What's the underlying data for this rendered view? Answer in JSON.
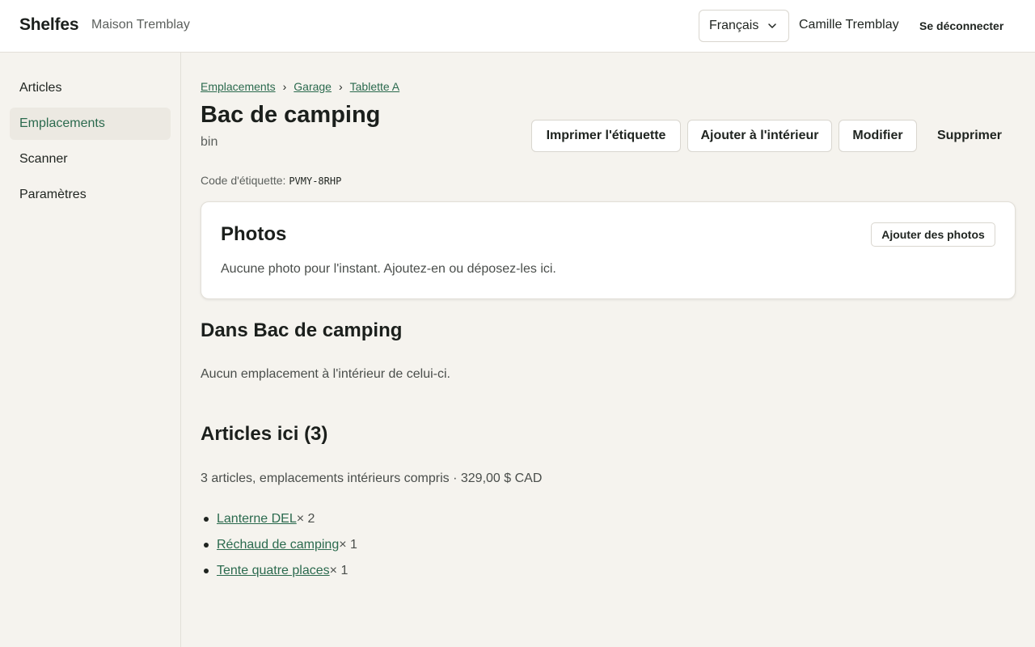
{
  "header": {
    "brand": "Shelfes",
    "household": "Maison Tremblay",
    "language": "Français",
    "user": "Camille Tremblay",
    "logout_label": "Se déconnecter"
  },
  "sidebar": {
    "items": [
      {
        "label": "Articles",
        "active": false
      },
      {
        "label": "Emplacements",
        "active": true
      },
      {
        "label": "Scanner",
        "active": false
      },
      {
        "label": "Paramètres",
        "active": false
      }
    ]
  },
  "breadcrumb": {
    "items": [
      "Emplacements",
      "Garage",
      "Tablette A"
    ],
    "separator": "›"
  },
  "location": {
    "title": "Bac de camping",
    "kind": "bin",
    "label_code_prefix": "Code d'étiquette:",
    "label_code": "PVMY-8RHP"
  },
  "actions": {
    "print_label": "Imprimer l'étiquette",
    "add_inside": "Ajouter à l'intérieur",
    "edit": "Modifier",
    "delete": "Supprimer"
  },
  "photos": {
    "title": "Photos",
    "add_label": "Ajouter des photos",
    "empty_text": "Aucune photo pour l'instant. Ajoutez-en ou déposez-les ici."
  },
  "inside": {
    "title": "Dans Bac de camping",
    "empty_text": "Aucun emplacement à l'intérieur de celui-ci."
  },
  "items_here": {
    "title": "Articles ici (3)",
    "summary": "3 articles, emplacements intérieurs compris · 329,00 $ CAD",
    "list": [
      {
        "name": "Lanterne DEL",
        "qty": "× 2"
      },
      {
        "name": "Réchaud de camping",
        "qty": "× 1"
      },
      {
        "name": "Tente quatre places",
        "qty": "× 1"
      }
    ]
  },
  "colors": {
    "accent": "#2b6a4e",
    "background": "#f5f3ee",
    "active_nav_bg": "#ece9e2"
  }
}
